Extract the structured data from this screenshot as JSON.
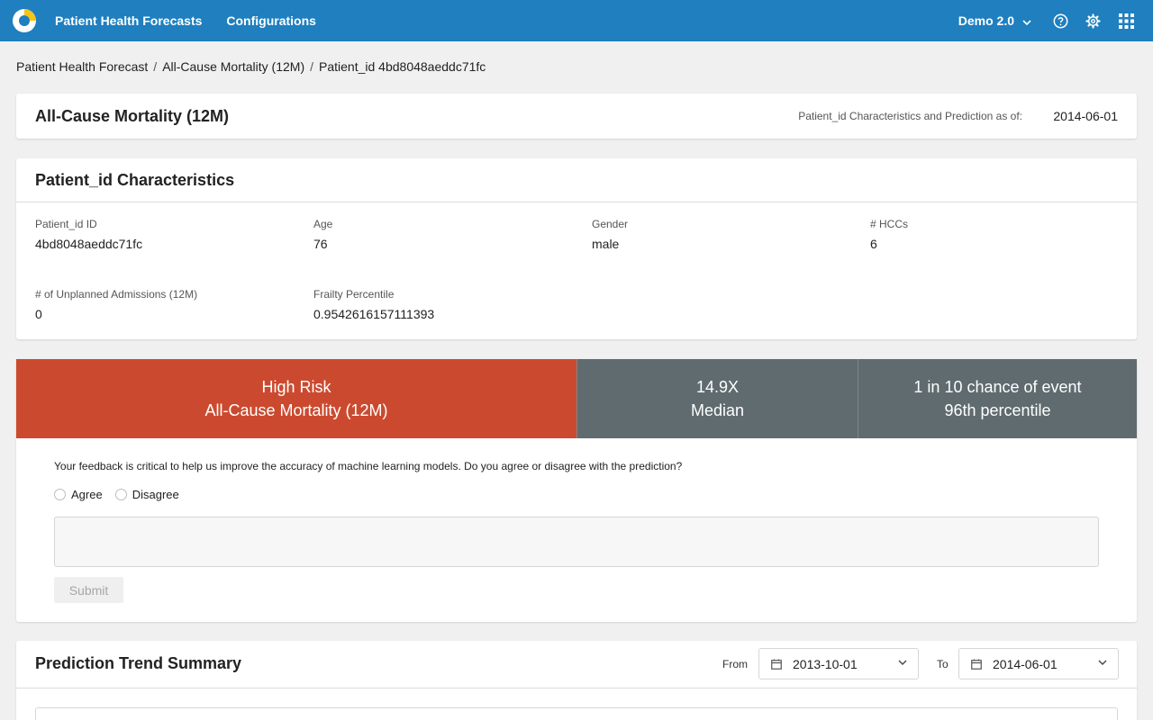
{
  "topbar": {
    "nav": [
      "Patient Health Forecasts",
      "Configurations"
    ],
    "org_label": "Demo 2.0",
    "icons": [
      "logo-icon",
      "chevron-down-icon",
      "help-icon",
      "gear-icon",
      "apps-grid-icon"
    ],
    "color": "#1f7fbf"
  },
  "breadcrumb": [
    "Patient Health Forecast",
    "All-Cause Mortality (12M)",
    "Patient_id 4bd8048aeddc71fc"
  ],
  "header": {
    "title": "All-Cause Mortality (12M)",
    "asof_label": "Patient_id Characteristics and Prediction as of:",
    "asof_date": "2014-06-01"
  },
  "characteristics": {
    "title": "Patient_id Characteristics",
    "fields": [
      {
        "label": "Patient_id ID",
        "value": "4bd8048aeddc71fc"
      },
      {
        "label": "Age",
        "value": "76"
      },
      {
        "label": "Gender",
        "value": "male"
      },
      {
        "label": "# HCCs",
        "value": "6"
      },
      {
        "label": "# of Unplanned Admissions (12M)",
        "value": "0"
      },
      {
        "label": "Frailty Percentile",
        "value": "0.9542616157111393"
      }
    ]
  },
  "risk": {
    "level": "High Risk",
    "outcome": "All-Cause Mortality (12M)",
    "multiplier": "14.9X",
    "multiplier_label": "Median",
    "chance": "1 in 10 chance of event",
    "percentile": "96th percentile",
    "high_color": "#cb4a2f",
    "neutral_color": "#5f6b6f"
  },
  "feedback": {
    "question": "Your feedback is critical to help us improve the accuracy of machine learning models. Do you agree or disagree with the prediction?",
    "options": [
      "Agree",
      "Disagree"
    ],
    "comment_value": "",
    "submit_label": "Submit"
  },
  "trend": {
    "title": "Prediction Trend Summary",
    "from_label": "From",
    "from_value": "2013-10-01",
    "to_label": "To",
    "to_value": "2014-06-01"
  }
}
